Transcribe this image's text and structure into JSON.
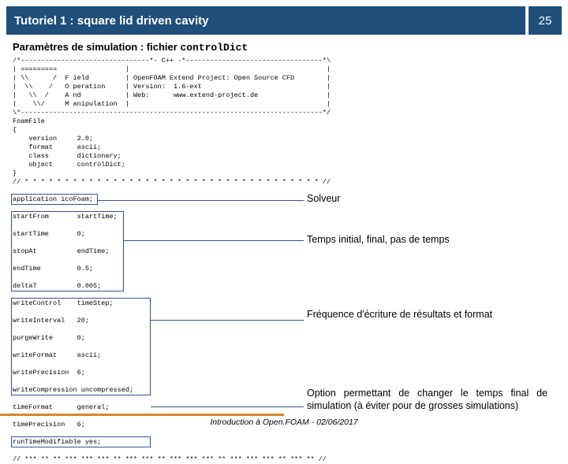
{
  "title": "Tutoriel 1 : square lid driven cavity",
  "page_number": "25",
  "subtitle_prefix": "Paramètres de simulation : fichier ",
  "subtitle_file": "controlDict",
  "code": "/*--------------------------------*- C++ -*----------------------------------*\\\n| =========                 |                                                 |\n| \\\\      /  F ield         | OpenFOAM Extend Project: Open Source CFD        |\n|  \\\\    /   O peration     | Version:  1.6-ext                               |\n|   \\\\  /    A nd           | Web:      www.extend-project.de                 |\n|    \\\\/     M anipulation  |                                                 |\n\\*---------------------------------------------------------------------------*/\nFoamFile\n{\n    version     2.0;\n    format      ascii;\n    class       dictionary;\n    object      controlDict;\n}\n// * * * * * * * * * * * * * * * * * * * * * * * * * * * * * * * * * * * * * //\n\napplication icoFoam;\n\nstartFrom       startTime;\n\nstartTime       0;\n\nstopAt          endTime;\n\nendTime         0.5;\n\ndeltaT          0.005;\n\nwriteControl    timeStep;\n\nwriteInterval   20;\n\npurgeWrite      0;\n\nwriteFormat     ascii;\n\nwritePrecision  6;\n\nwriteCompression uncompressed;\n\ntimeFormat      general;\n\ntimePrecision   6;\n\nrunTimeModifiable yes;\n\n// *** ** ** *** *** *** ** *** *** ** *** *** *** ** *** *** *** ** *** ** //",
  "annotations": {
    "solver": "Solveur",
    "time": "Temps initial, final, pas de temps",
    "write": "Fréquence d'écriture de résultats et format",
    "runtime": "Option permettant de changer le temps final de simulation (à éviter pour de grosses simulations)"
  },
  "footer": "Introduction à Open.FOAM - 02/06/2017"
}
